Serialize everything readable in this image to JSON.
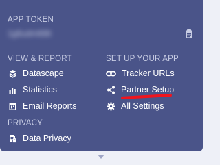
{
  "app_token": {
    "label": "APP TOKEN",
    "value_masked": "1g6udmt68t"
  },
  "view_report": {
    "heading": "VIEW & REPORT",
    "items": [
      {
        "label": "Datascape",
        "icon": "datascape-icon"
      },
      {
        "label": "Statistics",
        "icon": "bar-chart-icon"
      },
      {
        "label": "Email Reports",
        "icon": "calendar-report-icon"
      }
    ]
  },
  "setup_app": {
    "heading": "SET UP YOUR APP",
    "items": [
      {
        "label": "Tracker URLs",
        "icon": "link-icon"
      },
      {
        "label": "Partner Setup",
        "icon": "share-icon"
      },
      {
        "label": "All Settings",
        "icon": "gear-icon"
      }
    ]
  },
  "privacy": {
    "heading": "PRIVACY",
    "items": [
      {
        "label": "Data Privacy",
        "icon": "document-lock-icon"
      }
    ]
  },
  "colors": {
    "panel_bg": "#4a5489",
    "heading_text": "#c7cce3",
    "item_text": "#ffffff",
    "annotation_underline": "#f0141e"
  }
}
